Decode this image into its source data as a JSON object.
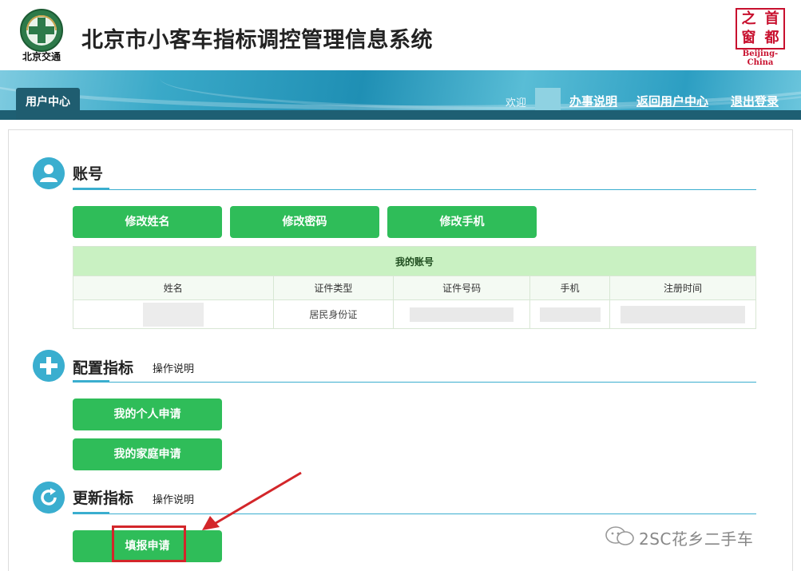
{
  "header": {
    "logo_text": "北京交通",
    "system_title": "北京市小客车指标调控管理信息系统",
    "seal_chars": [
      "之",
      "首",
      "窗",
      "都"
    ],
    "seal_caption": "Beijing-China"
  },
  "nav": {
    "tab_user_center": "用户中心",
    "welcome": "欢迎",
    "links": [
      "办事说明",
      "返回用户中心",
      "退出登录"
    ]
  },
  "account": {
    "title": "账号",
    "buttons": [
      "修改姓名",
      "修改密码",
      "修改手机"
    ],
    "table": {
      "caption": "我的账号",
      "columns": [
        "姓名",
        "证件类型",
        "证件号码",
        "手机",
        "注册时间"
      ],
      "row": {
        "id_type": "居民身份证"
      }
    }
  },
  "config_index": {
    "title": "配置指标",
    "help": "操作说明",
    "buttons": [
      "我的个人申请",
      "我的家庭申请"
    ]
  },
  "renew_index": {
    "title": "更新指标",
    "help": "操作说明",
    "buttons": [
      "填报申请"
    ]
  },
  "watermark": "2SC花乡二手车",
  "colors": {
    "accent": "#3aaecf",
    "button_green": "#2fbd59",
    "table_caption_bg": "#c9f1c2",
    "annotation_red": "#d3262a",
    "nav_dark": "#1f5d70"
  }
}
